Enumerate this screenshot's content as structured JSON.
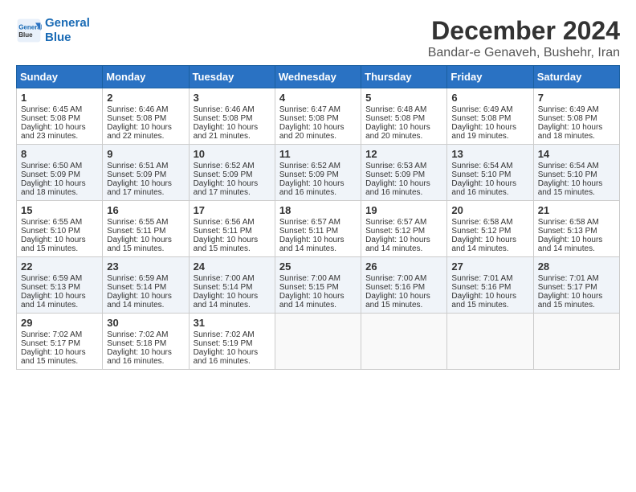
{
  "logo": {
    "line1": "General",
    "line2": "Blue"
  },
  "title": "December 2024",
  "subtitle": "Bandar-e Genaveh, Bushehr, Iran",
  "days_of_week": [
    "Sunday",
    "Monday",
    "Tuesday",
    "Wednesday",
    "Thursday",
    "Friday",
    "Saturday"
  ],
  "weeks": [
    [
      {
        "day": "1",
        "sunrise": "Sunrise: 6:45 AM",
        "sunset": "Sunset: 5:08 PM",
        "daylight": "Daylight: 10 hours and 23 minutes."
      },
      {
        "day": "2",
        "sunrise": "Sunrise: 6:46 AM",
        "sunset": "Sunset: 5:08 PM",
        "daylight": "Daylight: 10 hours and 22 minutes."
      },
      {
        "day": "3",
        "sunrise": "Sunrise: 6:46 AM",
        "sunset": "Sunset: 5:08 PM",
        "daylight": "Daylight: 10 hours and 21 minutes."
      },
      {
        "day": "4",
        "sunrise": "Sunrise: 6:47 AM",
        "sunset": "Sunset: 5:08 PM",
        "daylight": "Daylight: 10 hours and 20 minutes."
      },
      {
        "day": "5",
        "sunrise": "Sunrise: 6:48 AM",
        "sunset": "Sunset: 5:08 PM",
        "daylight": "Daylight: 10 hours and 20 minutes."
      },
      {
        "day": "6",
        "sunrise": "Sunrise: 6:49 AM",
        "sunset": "Sunset: 5:08 PM",
        "daylight": "Daylight: 10 hours and 19 minutes."
      },
      {
        "day": "7",
        "sunrise": "Sunrise: 6:49 AM",
        "sunset": "Sunset: 5:08 PM",
        "daylight": "Daylight: 10 hours and 18 minutes."
      }
    ],
    [
      {
        "day": "8",
        "sunrise": "Sunrise: 6:50 AM",
        "sunset": "Sunset: 5:09 PM",
        "daylight": "Daylight: 10 hours and 18 minutes."
      },
      {
        "day": "9",
        "sunrise": "Sunrise: 6:51 AM",
        "sunset": "Sunset: 5:09 PM",
        "daylight": "Daylight: 10 hours and 17 minutes."
      },
      {
        "day": "10",
        "sunrise": "Sunrise: 6:52 AM",
        "sunset": "Sunset: 5:09 PM",
        "daylight": "Daylight: 10 hours and 17 minutes."
      },
      {
        "day": "11",
        "sunrise": "Sunrise: 6:52 AM",
        "sunset": "Sunset: 5:09 PM",
        "daylight": "Daylight: 10 hours and 16 minutes."
      },
      {
        "day": "12",
        "sunrise": "Sunrise: 6:53 AM",
        "sunset": "Sunset: 5:09 PM",
        "daylight": "Daylight: 10 hours and 16 minutes."
      },
      {
        "day": "13",
        "sunrise": "Sunrise: 6:54 AM",
        "sunset": "Sunset: 5:10 PM",
        "daylight": "Daylight: 10 hours and 16 minutes."
      },
      {
        "day": "14",
        "sunrise": "Sunrise: 6:54 AM",
        "sunset": "Sunset: 5:10 PM",
        "daylight": "Daylight: 10 hours and 15 minutes."
      }
    ],
    [
      {
        "day": "15",
        "sunrise": "Sunrise: 6:55 AM",
        "sunset": "Sunset: 5:10 PM",
        "daylight": "Daylight: 10 hours and 15 minutes."
      },
      {
        "day": "16",
        "sunrise": "Sunrise: 6:55 AM",
        "sunset": "Sunset: 5:11 PM",
        "daylight": "Daylight: 10 hours and 15 minutes."
      },
      {
        "day": "17",
        "sunrise": "Sunrise: 6:56 AM",
        "sunset": "Sunset: 5:11 PM",
        "daylight": "Daylight: 10 hours and 15 minutes."
      },
      {
        "day": "18",
        "sunrise": "Sunrise: 6:57 AM",
        "sunset": "Sunset: 5:11 PM",
        "daylight": "Daylight: 10 hours and 14 minutes."
      },
      {
        "day": "19",
        "sunrise": "Sunrise: 6:57 AM",
        "sunset": "Sunset: 5:12 PM",
        "daylight": "Daylight: 10 hours and 14 minutes."
      },
      {
        "day": "20",
        "sunrise": "Sunrise: 6:58 AM",
        "sunset": "Sunset: 5:12 PM",
        "daylight": "Daylight: 10 hours and 14 minutes."
      },
      {
        "day": "21",
        "sunrise": "Sunrise: 6:58 AM",
        "sunset": "Sunset: 5:13 PM",
        "daylight": "Daylight: 10 hours and 14 minutes."
      }
    ],
    [
      {
        "day": "22",
        "sunrise": "Sunrise: 6:59 AM",
        "sunset": "Sunset: 5:13 PM",
        "daylight": "Daylight: 10 hours and 14 minutes."
      },
      {
        "day": "23",
        "sunrise": "Sunrise: 6:59 AM",
        "sunset": "Sunset: 5:14 PM",
        "daylight": "Daylight: 10 hours and 14 minutes."
      },
      {
        "day": "24",
        "sunrise": "Sunrise: 7:00 AM",
        "sunset": "Sunset: 5:14 PM",
        "daylight": "Daylight: 10 hours and 14 minutes."
      },
      {
        "day": "25",
        "sunrise": "Sunrise: 7:00 AM",
        "sunset": "Sunset: 5:15 PM",
        "daylight": "Daylight: 10 hours and 14 minutes."
      },
      {
        "day": "26",
        "sunrise": "Sunrise: 7:00 AM",
        "sunset": "Sunset: 5:16 PM",
        "daylight": "Daylight: 10 hours and 15 minutes."
      },
      {
        "day": "27",
        "sunrise": "Sunrise: 7:01 AM",
        "sunset": "Sunset: 5:16 PM",
        "daylight": "Daylight: 10 hours and 15 minutes."
      },
      {
        "day": "28",
        "sunrise": "Sunrise: 7:01 AM",
        "sunset": "Sunset: 5:17 PM",
        "daylight": "Daylight: 10 hours and 15 minutes."
      }
    ],
    [
      {
        "day": "29",
        "sunrise": "Sunrise: 7:02 AM",
        "sunset": "Sunset: 5:17 PM",
        "daylight": "Daylight: 10 hours and 15 minutes."
      },
      {
        "day": "30",
        "sunrise": "Sunrise: 7:02 AM",
        "sunset": "Sunset: 5:18 PM",
        "daylight": "Daylight: 10 hours and 16 minutes."
      },
      {
        "day": "31",
        "sunrise": "Sunrise: 7:02 AM",
        "sunset": "Sunset: 5:19 PM",
        "daylight": "Daylight: 10 hours and 16 minutes."
      },
      null,
      null,
      null,
      null
    ]
  ]
}
